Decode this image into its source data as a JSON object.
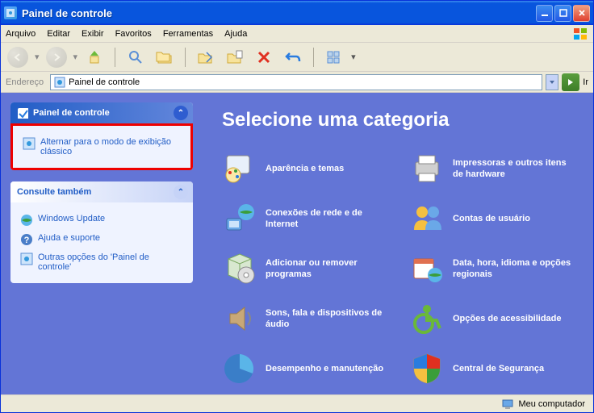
{
  "title": "Painel de controle",
  "menus": [
    "Arquivo",
    "Editar",
    "Exibir",
    "Favoritos",
    "Ferramentas",
    "Ajuda"
  ],
  "address": {
    "label": "Endereço",
    "value": "Painel de controle",
    "go": "Ir"
  },
  "sidebar": {
    "panel1": {
      "title": "Painel de controle",
      "link": "Alternar para o modo de exibição clássico"
    },
    "panel2": {
      "title": "Consulte também",
      "links": [
        "Windows Update",
        "Ajuda e suporte",
        "Outras opções do 'Painel de controle'"
      ]
    }
  },
  "main": {
    "heading": "Selecione uma categoria",
    "cats": [
      "Aparência e temas",
      "Impressoras e outros itens de hardware",
      "Conexões de rede e de Internet",
      "Contas de usuário",
      "Adicionar ou remover programas",
      "Data, hora, idioma e opções regionais",
      "Sons, fala e dispositivos de áudio",
      "Opções de acessibilidade",
      "Desempenho e manutenção",
      "Central de Segurança"
    ]
  },
  "status": "Meu computador"
}
